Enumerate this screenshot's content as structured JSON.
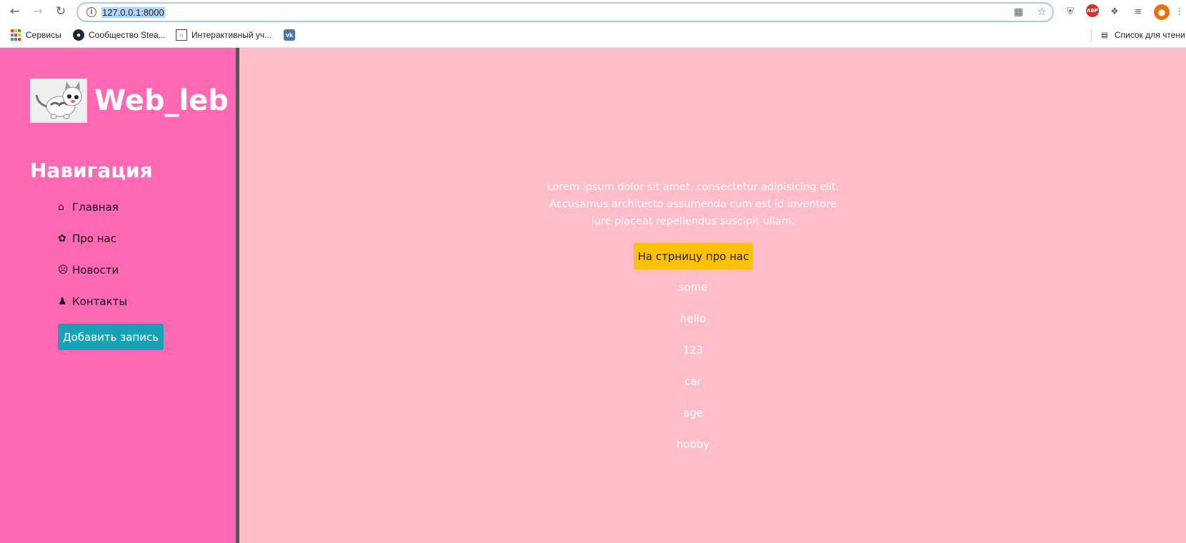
{
  "browser": {
    "url": "127.0.0.1:8000",
    "bookmarks": [
      {
        "label": "Сервисы"
      },
      {
        "label": "Сообщество Stea..."
      },
      {
        "label": "Интерактивный уч..."
      },
      {
        "label": ""
      }
    ],
    "reading_list": "Список для чтени"
  },
  "sidebar": {
    "brand": "Web_leb",
    "nav_title": "Навигация",
    "items": [
      {
        "label": "Главная",
        "icon": "home-icon"
      },
      {
        "label": "Про нас",
        "icon": "paw-icon"
      },
      {
        "label": "Новости",
        "icon": "angry-face-icon"
      },
      {
        "label": "Контакты",
        "icon": "cat-icon"
      }
    ],
    "add_button": "Добавить запись"
  },
  "main": {
    "title": "",
    "lead": "Lorem ipsum dolor sit amet, consectetur adipisicing elit. Accusamus architecto assumenda cum est id inventore iure placeat repellendus suscipit ullam.",
    "cta_button": "На стрницу про нас",
    "words": [
      "some",
      "hello",
      "123",
      "car",
      "age",
      "hobby"
    ]
  },
  "colors": {
    "sidebar_bg": "#ff69b4",
    "main_bg": "#ffbdca",
    "add_button": "#17a2b8",
    "cta_button": "#ffc107",
    "divider": "#555555"
  }
}
